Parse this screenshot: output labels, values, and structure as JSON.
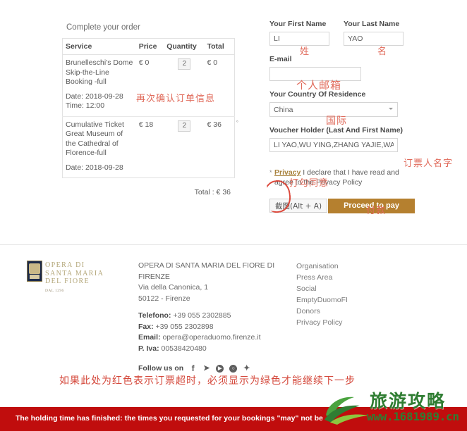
{
  "order": {
    "title": "Complete your order",
    "columns": [
      "Service",
      "Price",
      "Quantity",
      "Total"
    ],
    "rows": [
      {
        "service": "Brunelleschi's Dome Skip-the-Line Booking -full",
        "meta1": "Date: 2018-09-28",
        "meta2": "Time: 12:00",
        "price": "€ 0",
        "quantity": "2",
        "total": "€ 0",
        "mark": ""
      },
      {
        "service": "Cumulative Ticket Great Museum of the Cathedral of Florence-full",
        "meta1": "Date: 2018-09-28",
        "meta2": "",
        "price": "€ 18",
        "quantity": "2",
        "total": "€ 36",
        "mark": "°"
      }
    ],
    "total_label": "Total : € 36",
    "annotation": "再次确认订单信息"
  },
  "form": {
    "first_name": {
      "label": "Your First Name",
      "value": "LI",
      "annotation": "姓"
    },
    "last_name": {
      "label": "Your Last Name",
      "value": "YAO",
      "annotation": "名"
    },
    "email": {
      "label": "E-mail",
      "value": "",
      "placeholder": "",
      "annotation": "个人邮箱"
    },
    "country": {
      "label": "Your Country Of Residence",
      "value": "China",
      "options": [
        "China"
      ],
      "annotation": "国际"
    },
    "voucher": {
      "label": "Voucher Holder (Last And First Name)",
      "value": "LI YAO,WU YING,ZHANG YAJIE,WA",
      "annotation": "订票人名字"
    },
    "privacy": {
      "star": "*",
      "link": "Privacy",
      "text": "I declare that I have read and agree to the Privacy Policy",
      "annotation": "打勾同意"
    },
    "capture_chip": "截图(Alt + A)",
    "pay_button": "Proceed to pay",
    "pay_annotation": "付款"
  },
  "footer": {
    "brand": {
      "line1": "OPERA DI",
      "line2": "SANTA MARIA",
      "line3": "DEL FIORE",
      "since": "DAL 1296"
    },
    "contact": {
      "org1": "OPERA DI SANTA MARIA DEL FIORE DI",
      "org2": "FIRENZE",
      "address": "Via della Canonica, 1",
      "city": "50122 - Firenze",
      "phone_label": "Telefono:",
      "phone": "+39 055 2302885",
      "fax_label": "Fax:",
      "fax": "+39 055 2302898",
      "email_label": "Email:",
      "email": "opera@operaduomo.firenze.it",
      "vat_label": "P. Iva:",
      "vat": "00538420480",
      "follow_label": "Follow us on",
      "social": [
        "facebook-icon",
        "twitter-icon",
        "youtube-icon",
        "instagram-icon",
        "flickr-icon"
      ]
    },
    "links": [
      "Organisation",
      "Press Area",
      "Social",
      "EmptyDuomoFI",
      "Donors",
      "Privacy Policy"
    ]
  },
  "bottom_note": "如果此处为红色表示订票超时，必须显示为绿色才能继续下一步",
  "alert": {
    "text": "The holding time has finished: the times you requested for your bookings \"may\" not be"
  },
  "watermark": {
    "title": "旅游攻略",
    "url": "www.1681989.cn"
  },
  "colors": {
    "accent": "#b5802f",
    "alert": "#c00d0d",
    "annotation": "#e06a5a",
    "brand": "#b3a678",
    "watermark": "#2f7d32"
  }
}
